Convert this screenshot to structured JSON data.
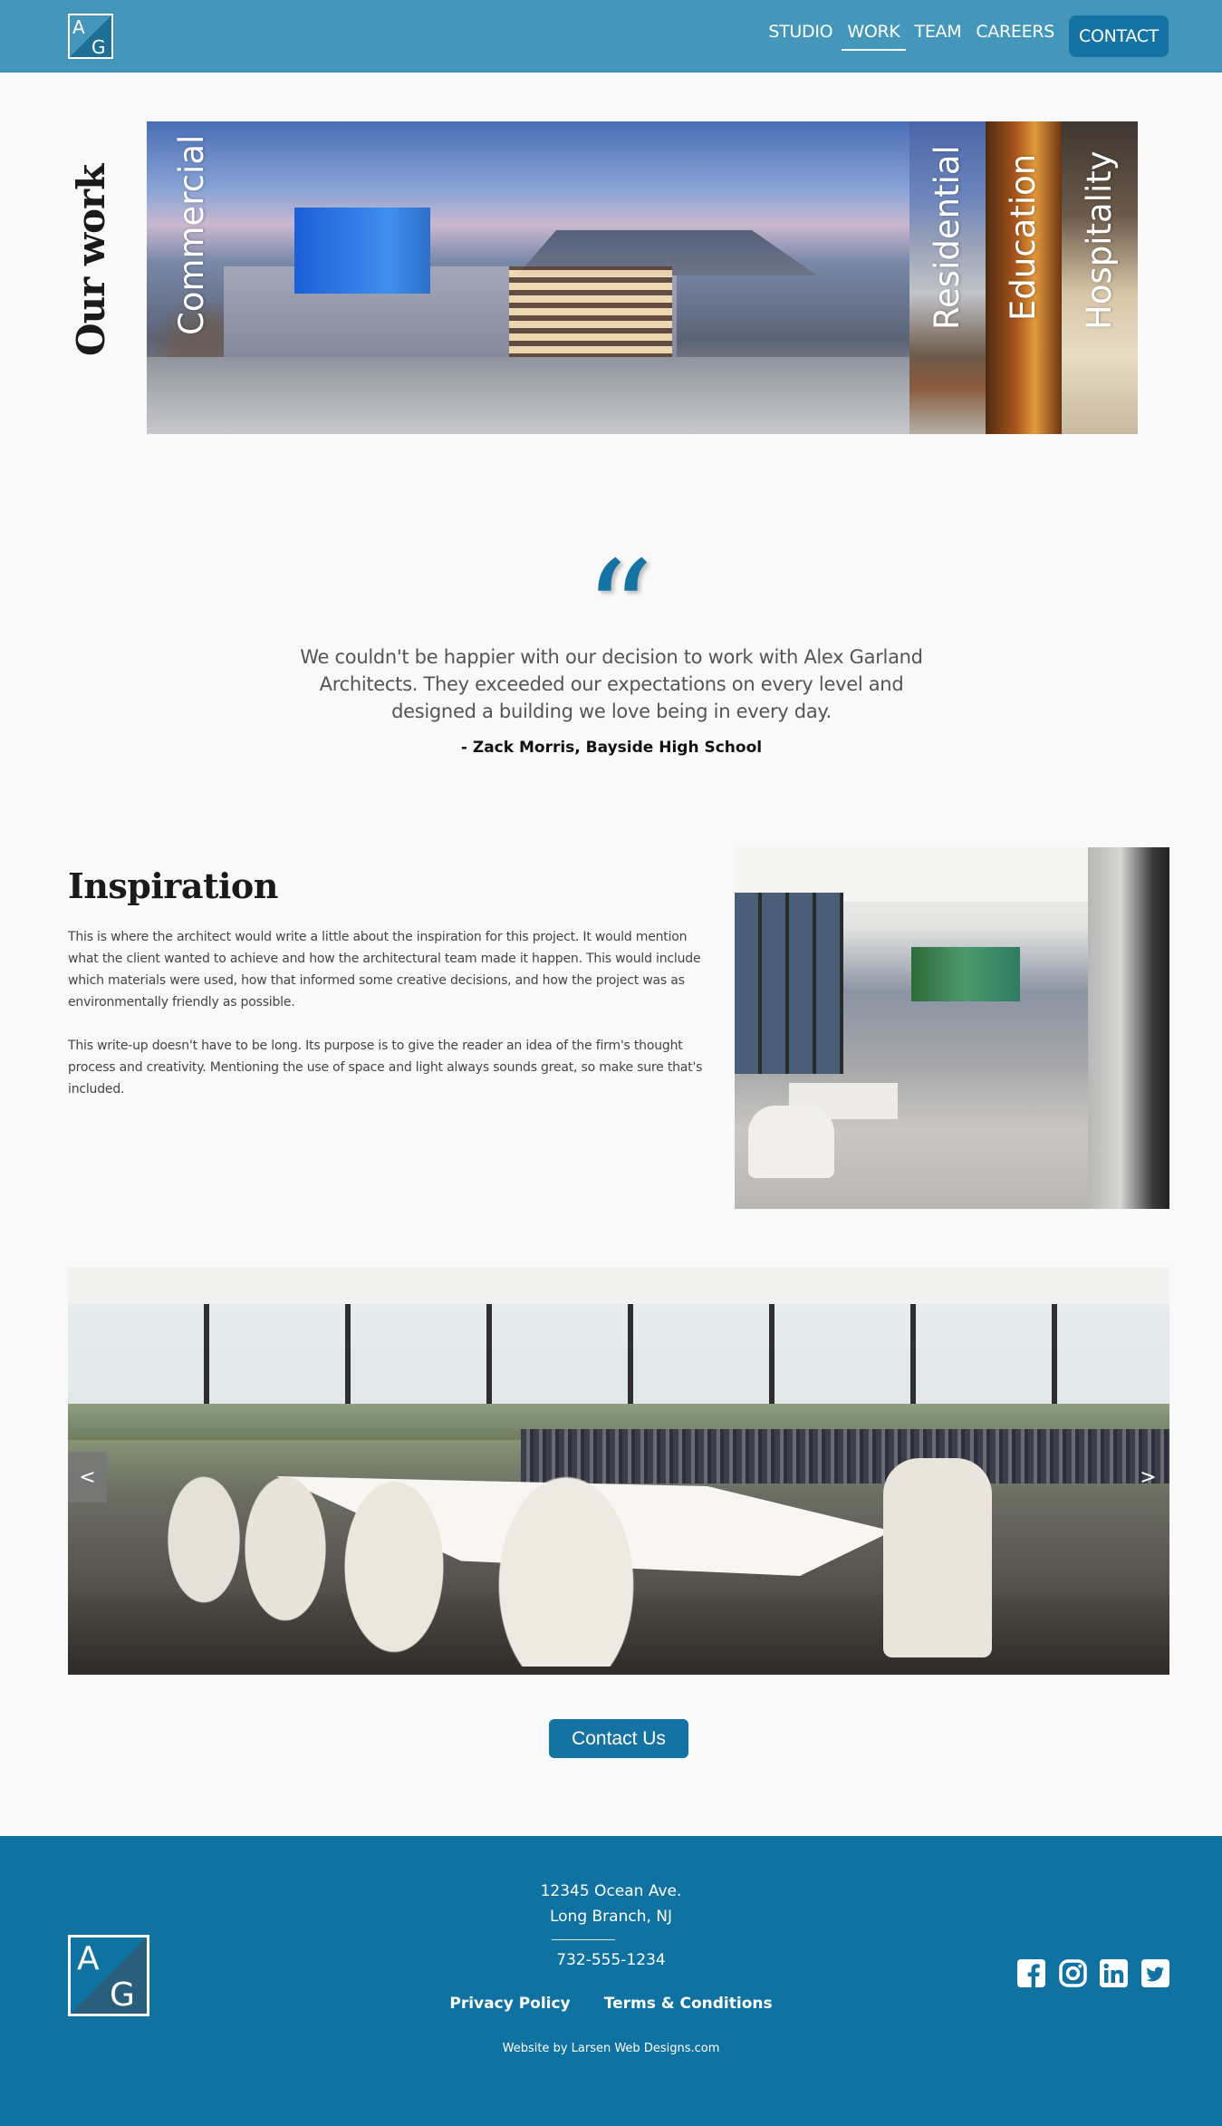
{
  "header": {
    "logo_letters": [
      "A",
      "G"
    ],
    "nav": [
      "STUDIO",
      "WORK",
      "TEAM",
      "CAREERS"
    ],
    "active": "WORK",
    "contact_label": "CONTACT"
  },
  "our_work": {
    "title": "Our work",
    "panels": [
      "Commercial",
      "Residential",
      "Education",
      "Hospitality"
    ]
  },
  "testimonial": {
    "quote_glyph": "“",
    "text": "We couldn't be happier with our decision to work with Alex Garland Architects. They exceeded our expectations on every level and designed a building we love being in every day.",
    "author": "- Zack Morris, Bayside High School"
  },
  "inspiration": {
    "title": "Inspiration",
    "paragraph1": "This is where the architect would write a little about the inspiration for this project. It would mention what the client wanted to achieve and how the architectural team made it happen. This would include which materials were used, how that informed some creative decisions, and how the project was as environmentally friendly as possible.",
    "paragraph2": "This write-up doesn't have to be long. Its purpose is to give the reader an idea of the firm's thought process and creativity. Mentioning the use of space and light always sounds great, so make sure that's included."
  },
  "slider": {
    "prev_label": "<",
    "next_label": ">"
  },
  "contact_button_label": "Contact Us",
  "footer": {
    "address_line1": "12345 Ocean Ave.",
    "address_line2": "Long Branch, NJ",
    "phone": "732-555-1234",
    "links": [
      "Privacy Policy",
      "Terms & Conditions"
    ],
    "credit": "Website by Larsen Web Designs.com",
    "social_icons": [
      "facebook-icon",
      "instagram-icon",
      "linkedin-icon",
      "twitter-icon"
    ]
  },
  "colors": {
    "header_bg": "#4496ba",
    "accent": "#1473a3",
    "footer_bg": "#0f72a1",
    "page_bg": "#f9f9f9"
  }
}
